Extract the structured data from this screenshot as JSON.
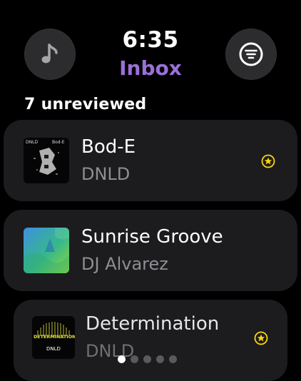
{
  "header": {
    "time": "6:35",
    "title": "Inbox",
    "left_button_icon": "music-note-icon",
    "right_button_icon": "filter-lines-icon"
  },
  "section": {
    "label": "7 unreviewed"
  },
  "tracks": [
    {
      "title": "Bod-E",
      "artist": "DNLD",
      "art_text_left": "DNLD",
      "art_text_right": "Bod-E",
      "starred": true
    },
    {
      "title": "Sunrise Groove",
      "artist": "DJ Alvarez",
      "starred": false
    },
    {
      "title": "Determination",
      "artist": "DNLD",
      "art_text_top": "DETERMINATION",
      "art_text_bottom": "DNLD",
      "starred": true
    }
  ],
  "pagination": {
    "count": 5,
    "active_index": 0
  },
  "colors": {
    "accent": "#9b70d8",
    "star": "#ffd60a",
    "card": "#1c1c1e",
    "button": "#2c2c2e",
    "secondary_text": "#8e8e93"
  }
}
